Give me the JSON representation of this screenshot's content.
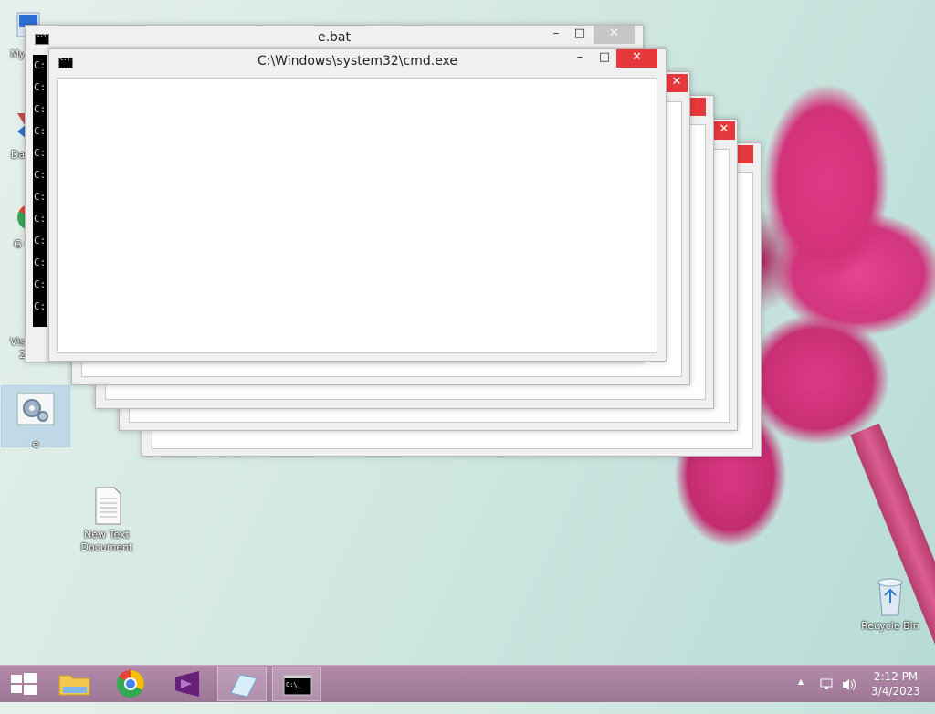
{
  "desktop": {
    "icons": [
      {
        "label": "My C"
      },
      {
        "label": "Data"
      },
      {
        "label": "G C"
      },
      {
        "label": "Visual St 2013"
      },
      {
        "label": "e"
      },
      {
        "label": "New Text Document"
      },
      {
        "label": "Recycle Bin"
      }
    ]
  },
  "windows": {
    "ebat": {
      "title": "e.bat"
    },
    "cmd": {
      "title": "C:\\Windows\\system32\\cmd.exe"
    },
    "cmd_prompt": "C:"
  },
  "controls": {
    "minimize": "–",
    "maximize": "□",
    "close": "✕"
  },
  "taskbar": {
    "items": [
      "start",
      "file-explorer",
      "chrome",
      "visual-studio",
      "notepad",
      "cmd"
    ],
    "clock_time": "2:12 PM",
    "clock_date": "3/4/2023",
    "tray_arrow": "▲"
  },
  "colors": {
    "close_red": "#e5393b",
    "taskbar": "#a57e9d"
  }
}
